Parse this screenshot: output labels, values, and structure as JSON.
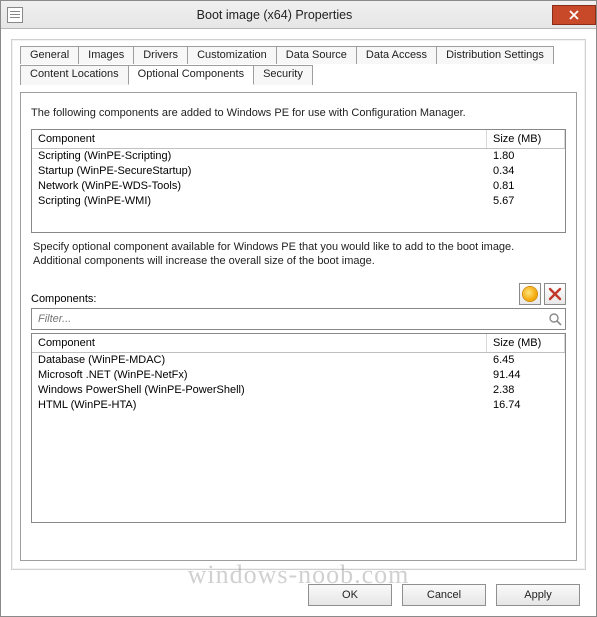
{
  "window": {
    "title": "Boot image (x64) Properties"
  },
  "tabs": {
    "row1": [
      "General",
      "Images",
      "Drivers",
      "Customization",
      "Data Source",
      "Data Access",
      "Distribution Settings"
    ],
    "row2": [
      "Content Locations",
      "Optional Components",
      "Security"
    ],
    "active": "Optional Components"
  },
  "panel": {
    "intro": "The following components are added to Windows PE for use with Configuration Manager.",
    "top_columns": {
      "component": "Component",
      "size": "Size (MB)"
    },
    "added_components": [
      {
        "name": "Scripting (WinPE-Scripting)",
        "size": "1.80"
      },
      {
        "name": "Startup (WinPE-SecureStartup)",
        "size": "0.34"
      },
      {
        "name": "Network (WinPE-WDS-Tools)",
        "size": "0.81"
      },
      {
        "name": "Scripting (WinPE-WMI)",
        "size": "5.67"
      }
    ],
    "help": "Specify optional component available for Windows PE that you would like to add to the boot image. Additional components will increase the overall size of the boot image.",
    "components_label": "Components:",
    "filter_placeholder": "Filter...",
    "bottom_columns": {
      "component": "Component",
      "size": "Size (MB)"
    },
    "available_components": [
      {
        "name": "Database (WinPE-MDAC)",
        "size": "6.45"
      },
      {
        "name": "Microsoft .NET (WinPE-NetFx)",
        "size": "91.44"
      },
      {
        "name": "Windows PowerShell (WinPE-PowerShell)",
        "size": "2.38"
      },
      {
        "name": "HTML (WinPE-HTA)",
        "size": "16.74"
      }
    ]
  },
  "buttons": {
    "ok": "OK",
    "cancel": "Cancel",
    "apply": "Apply"
  },
  "watermark": "windows-noob.com"
}
